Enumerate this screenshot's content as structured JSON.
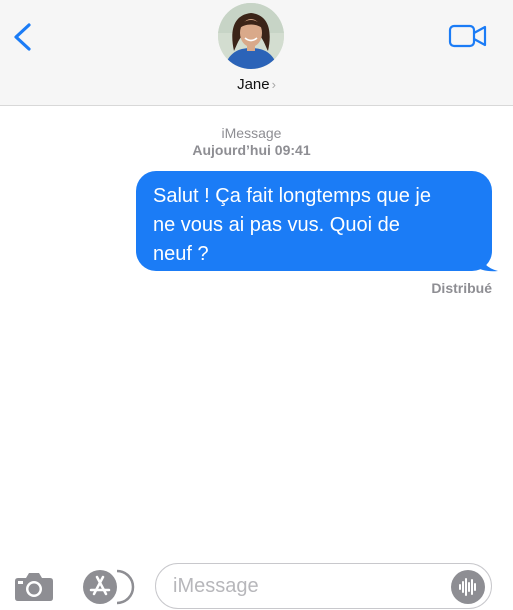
{
  "header": {
    "contact_name": "Jane",
    "chevron": "›",
    "back_icon": "chevron-left-icon",
    "video_icon": "video-camera-icon",
    "accent_color": "#1b7cf6"
  },
  "conversation": {
    "service_label": "iMessage",
    "timestamp": "Aujourd’hui 09:41",
    "messages": [
      {
        "direction": "outgoing",
        "lines": [
          "Salut ! Ça fait longtemps que je",
          "ne vous ai pas vus. Quoi de",
          "neuf ?"
        ],
        "bubble_color": "#1b7cf6"
      }
    ],
    "status": "Distribué"
  },
  "composer": {
    "placeholder": "iMessage",
    "camera_icon": "camera-icon",
    "apps_icon": "app-store-icon",
    "audio_icon": "waveform-icon"
  }
}
